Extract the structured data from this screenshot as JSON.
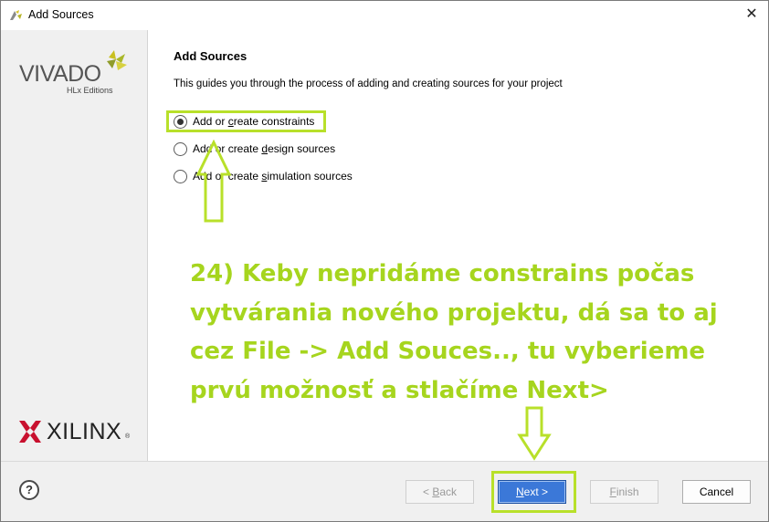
{
  "window": {
    "title": "Add Sources",
    "close_glyph": "✕"
  },
  "sidebar": {
    "vivado_logo_text": "VIVADO",
    "vivado_logo_subtext": "HLx Editions",
    "xilinx_logo_text": "XILINX",
    "xilinx_logo_reg": "®"
  },
  "main": {
    "title": "Add Sources",
    "description": "This guides you through the process of adding and creating sources for your project",
    "options": [
      {
        "prefix": "Add or ",
        "mnemonic": "c",
        "suffix": "reate constraints",
        "selected": true
      },
      {
        "prefix": "Add or create ",
        "mnemonic": "d",
        "suffix": "esign sources",
        "selected": false
      },
      {
        "prefix": "Add or create ",
        "mnemonic": "s",
        "suffix": "imulation sources",
        "selected": false
      }
    ]
  },
  "annotation": {
    "lines": [
      "24) Keby nepridáme constrains počas",
      "vytvárania nového projektu, dá sa to aj",
      "cez File -> Add Souces.., tu vyberieme",
      "prvú možnosť a stlačíme Next>"
    ],
    "color": "#a6d51e"
  },
  "footer": {
    "help_label": "?",
    "back": {
      "prefix": "< ",
      "mnemonic": "B",
      "suffix": "ack"
    },
    "next": {
      "prefix": "",
      "mnemonic": "N",
      "suffix": "ext >"
    },
    "finish": {
      "prefix": "",
      "mnemonic": "F",
      "suffix": "inish"
    },
    "cancel_label": "Cancel"
  },
  "colors": {
    "accent_highlight": "#b8e02a",
    "primary_button": "#3b78d8",
    "sidebar_bg": "#f0f0f0"
  }
}
